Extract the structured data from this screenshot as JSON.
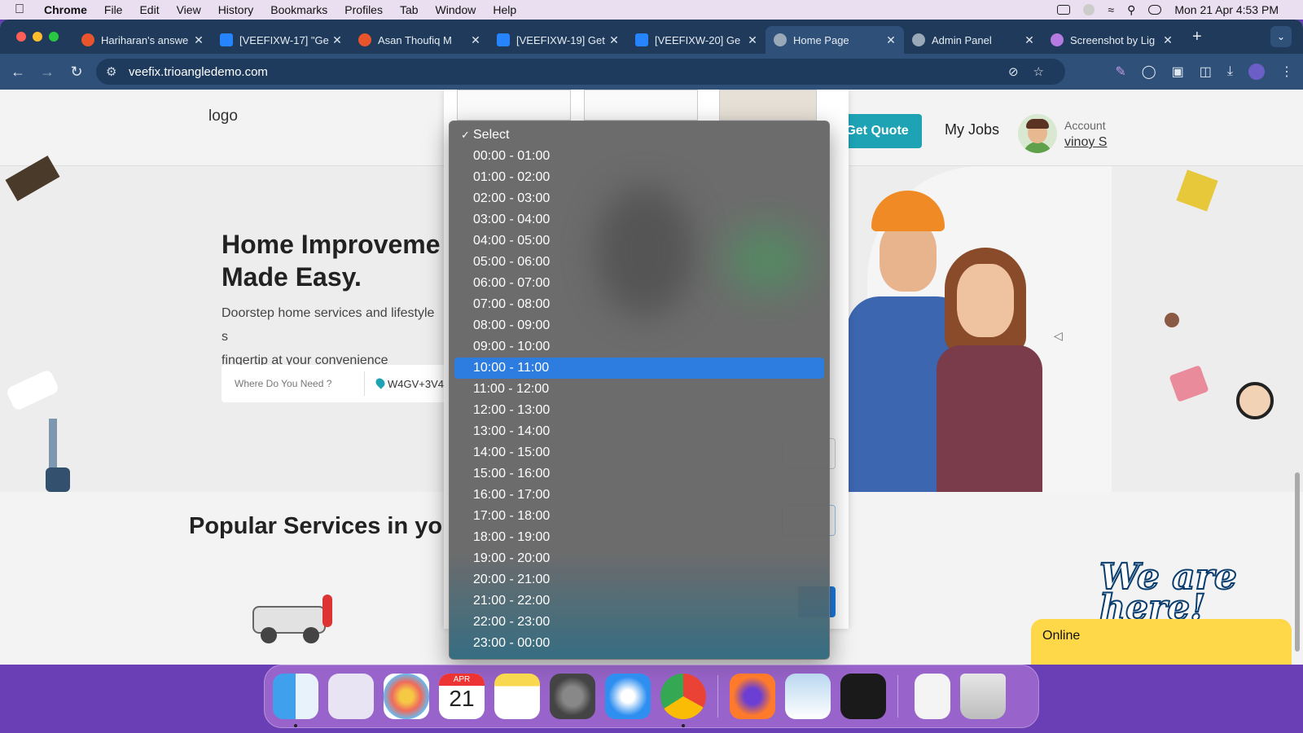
{
  "menubar": {
    "app": "Chrome",
    "items": [
      "File",
      "Edit",
      "View",
      "History",
      "Bookmarks",
      "Profiles",
      "Tab",
      "Window",
      "Help"
    ],
    "datetime": "Mon 21 Apr  4:53 PM"
  },
  "tabs": [
    {
      "title": "Hariharan's answe",
      "active": false
    },
    {
      "title": "[VEEFIXW-17] \"Ge",
      "active": false
    },
    {
      "title": "Asan Thoufiq M",
      "active": false
    },
    {
      "title": "[VEEFIXW-19] Get",
      "active": false
    },
    {
      "title": "[VEEFIXW-20] Ge",
      "active": false
    },
    {
      "title": "Home Page",
      "active": true
    },
    {
      "title": "Admin Panel",
      "active": false
    },
    {
      "title": "Screenshot by Lig",
      "active": false
    }
  ],
  "address": {
    "url": "veefix.trioangledemo.com"
  },
  "site": {
    "logo_alt": "logo",
    "get_quote": "Get Quote",
    "my_jobs": "My Jobs",
    "account_label": "Account",
    "account_name": "vinoy S",
    "hero_title": "Home Improveme Made Easy.",
    "hero_title_line1": "Home Improveme",
    "hero_title_line2": "Made Easy.",
    "hero_sub_line1": "Doorstep home services and lifestyle s",
    "hero_sub_line2": "fingertip at your convenience",
    "where_placeholder": "Where Do You Need ?",
    "location": "W4GV+3V4",
    "popular": "Popular Services in you"
  },
  "dropdown": {
    "selected_index": 11,
    "options": [
      "Select",
      "00:00 - 01:00",
      "01:00 - 02:00",
      "02:00 - 03:00",
      "03:00 - 04:00",
      "04:00 - 05:00",
      "05:00 - 06:00",
      "06:00 - 07:00",
      "07:00 - 08:00",
      "08:00 - 09:00",
      "09:00 - 10:00",
      "10:00 - 11:00",
      "11:00 - 12:00",
      "12:00 - 13:00",
      "13:00 - 14:00",
      "14:00 - 15:00",
      "15:00 - 16:00",
      "16:00 - 17:00",
      "17:00 - 18:00",
      "18:00 - 19:00",
      "19:00 - 20:00",
      "20:00 - 21:00",
      "21:00 - 22:00",
      "22:00 - 23:00",
      "23:00 - 00:00"
    ]
  },
  "chat": {
    "logo_text": "We are here!",
    "status": "Online"
  },
  "dock": {
    "calendar_month": "APR",
    "calendar_day": "21"
  }
}
